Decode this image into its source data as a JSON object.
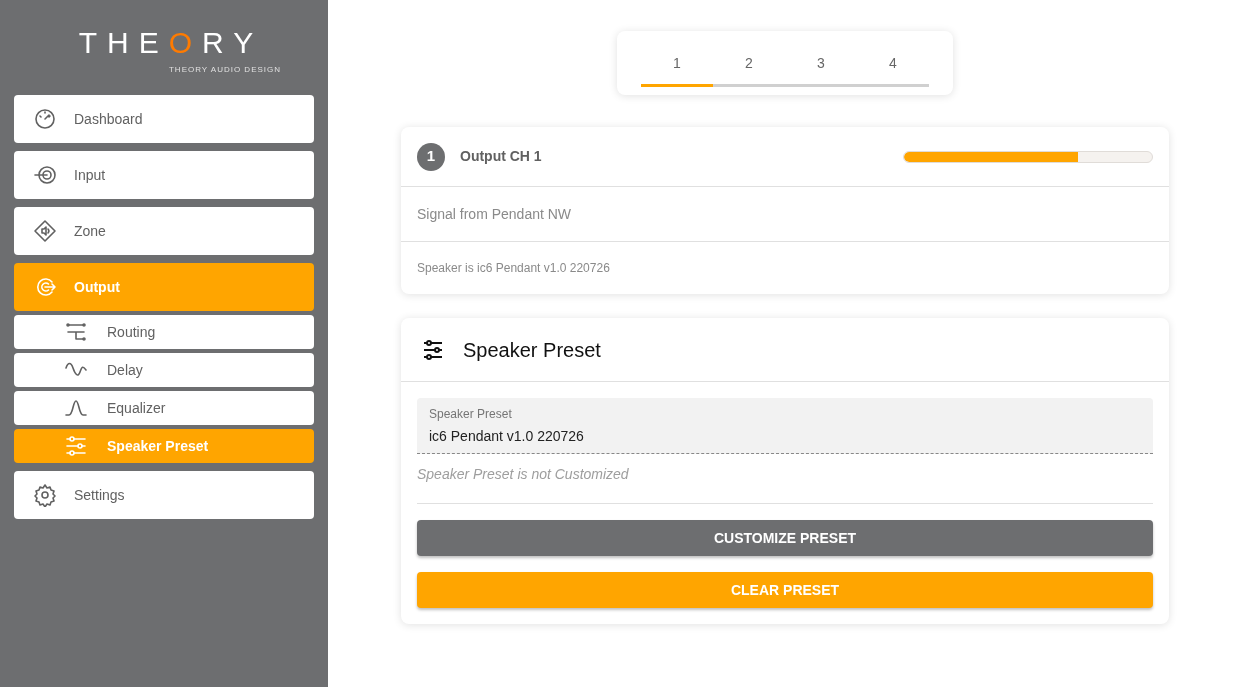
{
  "logo": {
    "text": "THEORY",
    "subtitle": "THEORY AUDIO DESIGN"
  },
  "sidebar": {
    "items": [
      {
        "label": "Dashboard",
        "kind": "main",
        "selected": false
      },
      {
        "label": "Input",
        "kind": "main",
        "selected": false
      },
      {
        "label": "Zone",
        "kind": "main",
        "selected": false
      },
      {
        "label": "Output",
        "kind": "main",
        "selected": true
      },
      {
        "label": "Routing",
        "kind": "sub",
        "selected": false
      },
      {
        "label": "Delay",
        "kind": "sub",
        "selected": false
      },
      {
        "label": "Equalizer",
        "kind": "sub",
        "selected": false
      },
      {
        "label": "Speaker Preset",
        "kind": "sub",
        "selected": true
      },
      {
        "label": "Settings",
        "kind": "main",
        "selected": false
      }
    ]
  },
  "tabs": [
    {
      "label": "1",
      "selected": true
    },
    {
      "label": "2",
      "selected": false
    },
    {
      "label": "3",
      "selected": false
    },
    {
      "label": "4",
      "selected": false
    }
  ],
  "channel": {
    "number": "1",
    "title": "Output CH 1",
    "level": 0.7,
    "signal": "Signal from Pendant NW",
    "speaker": "Speaker is ic6 Pendant v1.0 220726"
  },
  "preset": {
    "title": "Speaker Preset",
    "field_label": "Speaker Preset",
    "value": "ic6 Pendant v1.0 220726",
    "hint": "Speaker Preset is not Customized",
    "buttons": [
      {
        "label": "CUSTOMIZE PRESET",
        "kind": "secondary"
      },
      {
        "label": "CLEAR PRESET",
        "kind": "primary"
      }
    ]
  }
}
